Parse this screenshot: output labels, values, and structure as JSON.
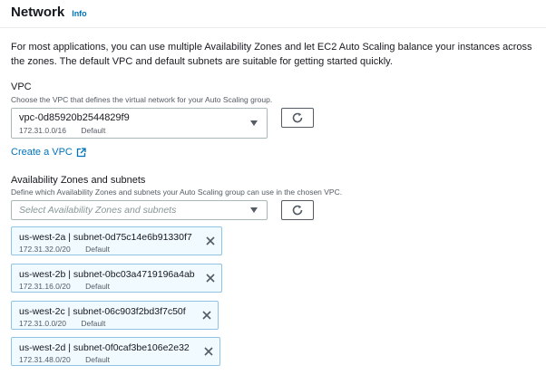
{
  "header": {
    "title": "Network",
    "info_label": "Info"
  },
  "description": "For most applications, you can use multiple Availability Zones and let EC2 Auto Scaling balance your instances across the zones. The default VPC and default subnets are suitable for getting started quickly.",
  "vpc": {
    "label": "VPC",
    "hint": "Choose the VPC that defines the virtual network for your Auto Scaling group.",
    "selected_value": "vpc-0d85920b2544829f9",
    "selected_cidr": "172.31.0.0/16",
    "selected_tag": "Default",
    "create_link": "Create a VPC"
  },
  "azs": {
    "label": "Availability Zones and subnets",
    "hint": "Define which Availability Zones and subnets your Auto Scaling group can use in the chosen VPC.",
    "placeholder": "Select Availability Zones and subnets",
    "tokens": [
      {
        "main": "us-west-2a | subnet-0d75c14e6b91330f7",
        "cidr": "172.31.32.0/20",
        "tag": "Default"
      },
      {
        "main": "us-west-2b | subnet-0bc03a4719196a4ab",
        "cidr": "172.31.16.0/20",
        "tag": "Default"
      },
      {
        "main": "us-west-2c | subnet-06c903f2bd3f7c50f",
        "cidr": "172.31.0.0/20",
        "tag": "Default"
      },
      {
        "main": "us-west-2d | subnet-0f0caf3be106e2e32",
        "cidr": "172.31.48.0/20",
        "tag": "Default"
      }
    ]
  },
  "icons": {
    "refresh": "refresh-icon",
    "external": "external-link-icon",
    "remove": "close-icon",
    "dropdown": "caret-down-icon"
  }
}
